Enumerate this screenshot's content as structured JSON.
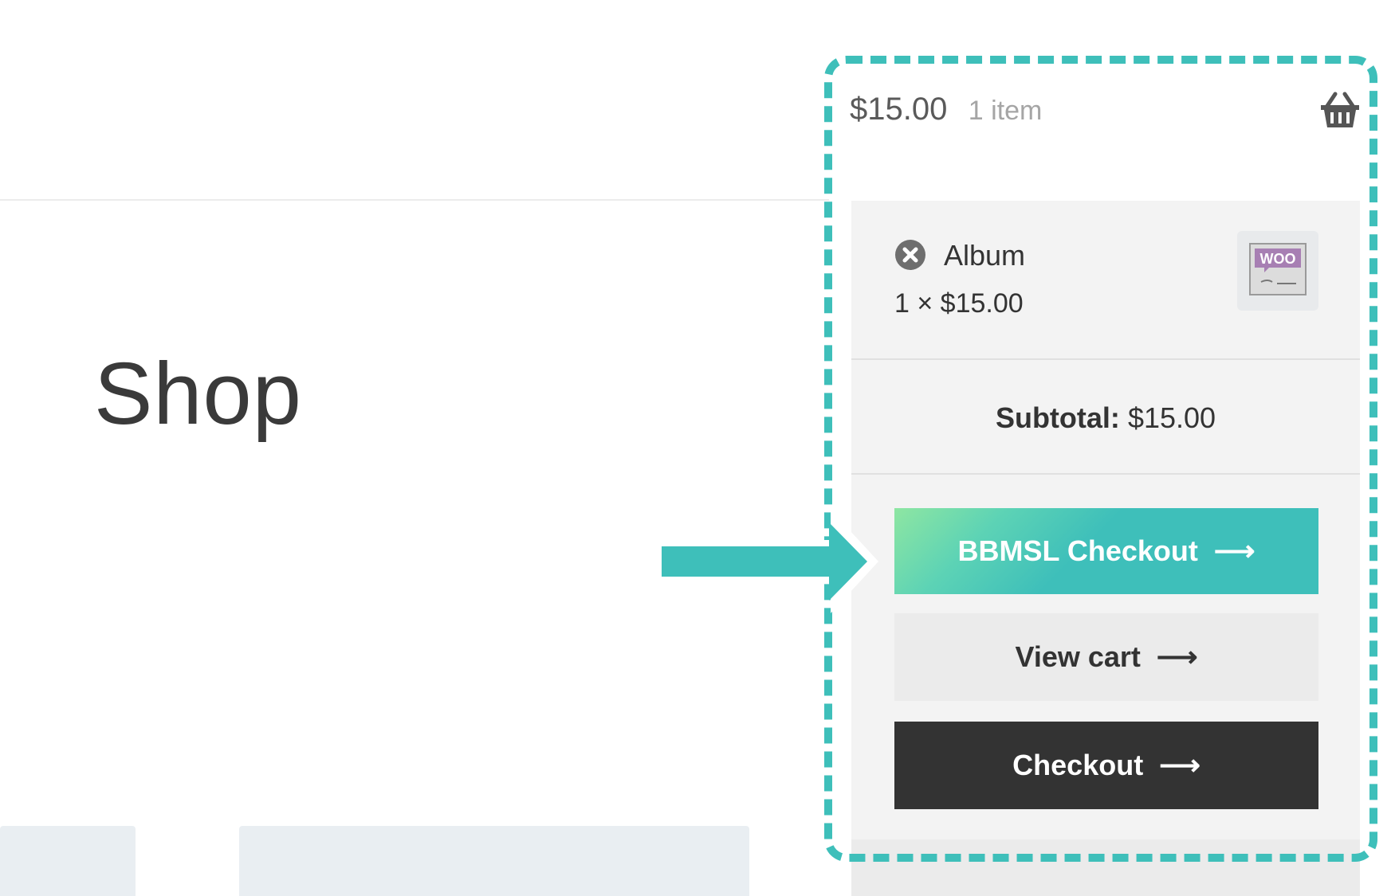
{
  "page": {
    "title": "Shop"
  },
  "cart": {
    "total": "$15.00",
    "count": "1 item",
    "icon": "basket-icon",
    "item": {
      "name": "Album",
      "quantity_price": "1 × $15.00",
      "remove_icon": "close-circle-icon",
      "thumbnail_text": "WOO"
    },
    "subtotal": {
      "label": "Subtotal:",
      "value": "$15.00"
    },
    "buttons": {
      "bbmsl_checkout": "BBMSL Checkout",
      "view_cart": "View cart",
      "checkout": "Checkout"
    },
    "arrow_glyph": "⟶"
  },
  "colors": {
    "accent": "#3ebfba",
    "gradient_start": "#8ee6a2",
    "dark_button": "#333333",
    "panel_bg": "#f3f3f3",
    "light_button": "#ebebeb"
  }
}
